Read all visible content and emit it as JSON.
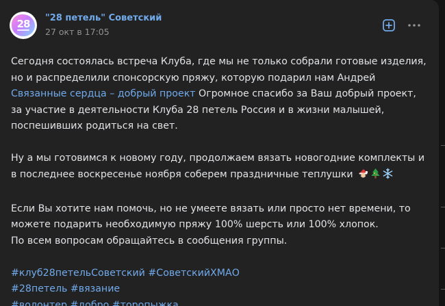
{
  "post": {
    "group_name": "\"28 петель\" Советский",
    "date": "27 окт в 17:05",
    "avatar_text": "28",
    "paragraph1": {
      "text_before": "Сегодня состоялась встреча Клуба, где мы не только собрали готовые изделия, но и распределили спонсорскую пряжу, которую подарил нам Андрей ",
      "link_text": "Связанные сердца – добрый проект",
      "text_after": " Огромное спасибо за Ваш добрый проект, за участие в деятельности Клуба 28 петель Россия и в жизни малышей, поспешивших родиться на свет."
    },
    "paragraph2": {
      "text": "Ну а мы готовимся к новому году, продолжаем вязать новогодние комплекты и в последнее воскресенье ноября соберем праздничные теплушки",
      "emojis": [
        "santa-emoji",
        "christmas-tree-emoji",
        "snowflake-emoji"
      ]
    },
    "paragraph3": {
      "line1": "Если Вы хотите нам помочь, но не умеете вязать или просто нет времени, то можете подарить необходимую пряжу 100% шерсть или 100% хлопок.",
      "line2": "По всем вопросам обращайтесь в сообщения группы."
    },
    "hashtags": [
      [
        "#клуб28петельСоветский",
        "#СоветскийХМАО"
      ],
      [
        "#28петель",
        "#вязание"
      ],
      [
        "#волонтер",
        "#добро",
        "#торопыжка"
      ]
    ]
  },
  "icons": {
    "add": "plus-square-icon",
    "more": "more-horizontal-icon"
  },
  "colors": {
    "background": "#141414",
    "card": "#222222",
    "link": "#71aaeb",
    "text": "#e1e3e6",
    "muted": "#939393"
  }
}
